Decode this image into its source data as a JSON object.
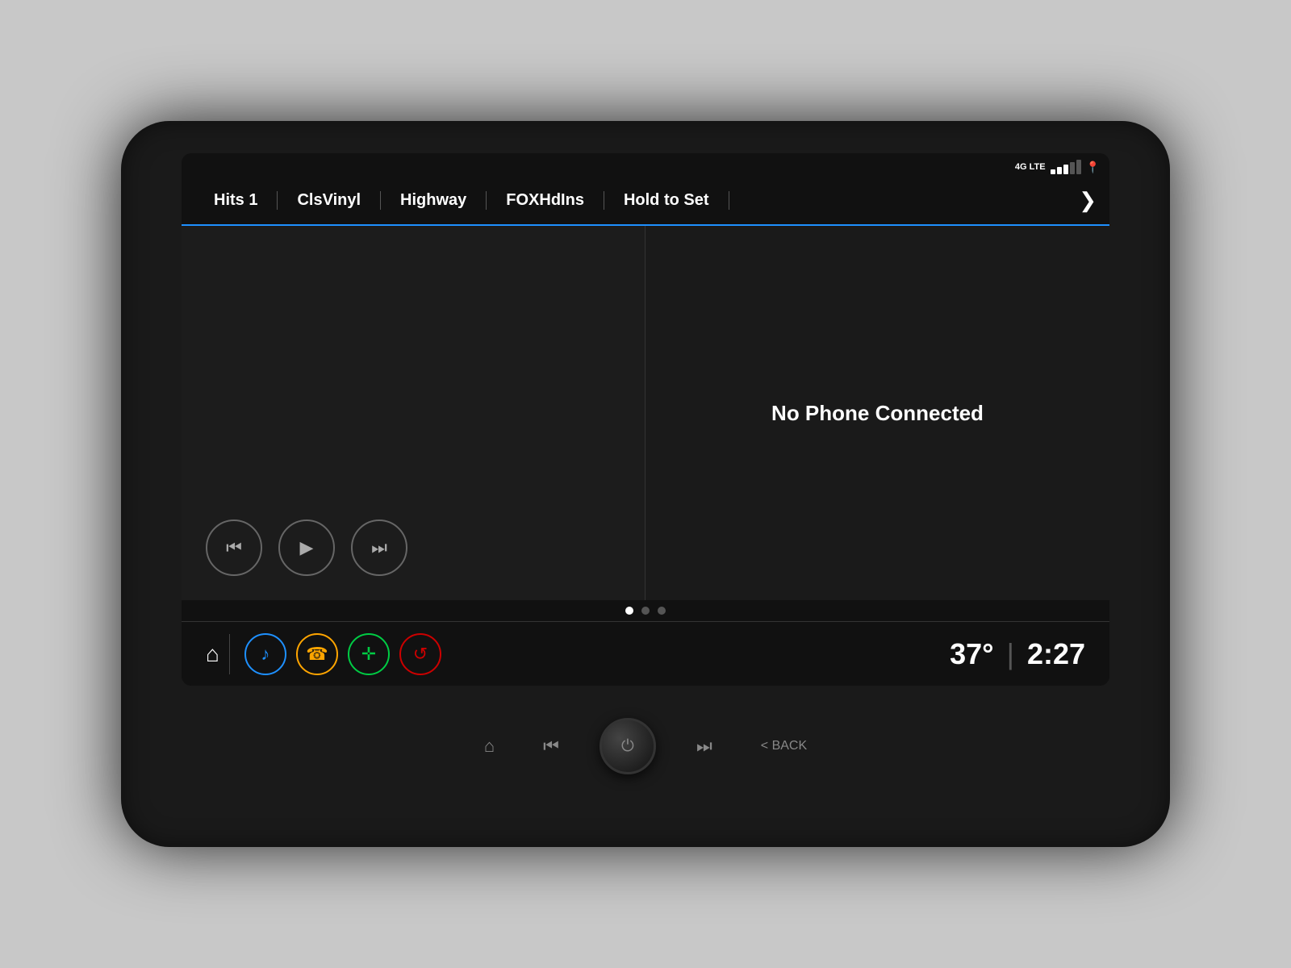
{
  "status": {
    "network": "4G LTE",
    "signal_bars": [
      true,
      true,
      true,
      false,
      false
    ],
    "location_icon": "📍"
  },
  "nav_tabs": {
    "items": [
      {
        "label": "Hits 1",
        "active": false
      },
      {
        "label": "ClsVinyl",
        "active": false
      },
      {
        "label": "Highway",
        "active": false
      },
      {
        "label": "FOXHdIns",
        "active": false
      },
      {
        "label": "Hold to Set",
        "active": false
      }
    ],
    "arrow": "❯"
  },
  "media_player": {
    "prev_icon": "⏮",
    "play_icon": "▶",
    "next_icon": "⏭"
  },
  "phone_panel": {
    "message": "No Phone Connected"
  },
  "page_dots": [
    true,
    false,
    false
  ],
  "bottom_nav": {
    "home_icon": "⌂",
    "icons": [
      {
        "type": "music",
        "symbol": "♪",
        "color": "#1e90ff"
      },
      {
        "type": "phone",
        "symbol": "📞",
        "color": "#ffa500"
      },
      {
        "type": "nav",
        "symbol": "✛",
        "color": "#00cc44"
      },
      {
        "type": "onstar",
        "symbol": "⟳",
        "color": "#cc0000"
      }
    ],
    "temperature": "37°",
    "time": "2:27"
  },
  "physical_buttons": {
    "home_label": "⌂",
    "prev_label": "⏮",
    "power_label": "⏻",
    "next_label": "⏭",
    "back_label": "< BACK"
  }
}
